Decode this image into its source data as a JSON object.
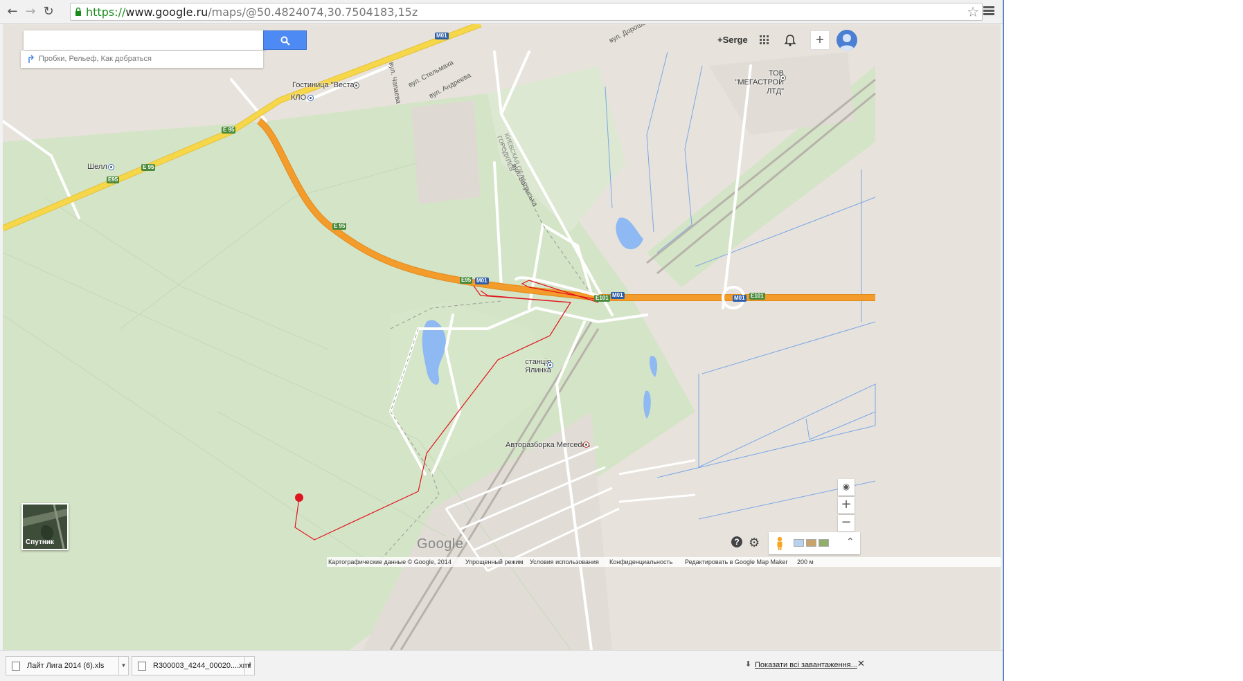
{
  "browser": {
    "url_scheme": "https://",
    "url_host": "www.google.ru",
    "url_path": "/maps/@50.4824074,30.7504183,15z",
    "back_icon": "arrow-left-icon",
    "forward_icon": "arrow-right-icon",
    "reload_icon": "reload-icon",
    "star_icon": "star-icon",
    "menu_icon": "hamburger-menu-icon"
  },
  "search": {
    "value": "",
    "hints": "Пробки, Рельеф, Как добраться"
  },
  "account": {
    "user_name": "+Serge",
    "apps_icon": "apps-grid-icon",
    "bell_icon": "bell-icon",
    "add_label": "+",
    "avatar_icon": "avatar-icon"
  },
  "map": {
    "labels": {
      "hotel": "Гостиница \"Веста\"",
      "klo": "КЛО",
      "shell": "Шелл",
      "company": "ТОВ \"МЕГАСТРОЙ ЛТД\"",
      "station": "станція Ялинка",
      "autoparts": "Авторазборка Mercedes",
      "street_bogunska": "вул. Богунська",
      "region_border": "КИЕВСКАЯ ОБЛАСТЬ ГОРОДКИЕВ",
      "street_stelmakha": "вул. Стельмаха",
      "street_andreeva": "вул. Андреева",
      "street_chapaeva": "вул. Чапаева",
      "street_doroshenka": "вул. Дорошенка"
    },
    "shields": [
      "M01",
      "E 95",
      "E 95",
      "E95",
      "E 95",
      "E95",
      "M01",
      "E101",
      "M01",
      "M01",
      "E101"
    ],
    "route_color": "#e0141e",
    "highway_color": "#f39c2b",
    "arterial_color": "#f7d74a",
    "water_color": "#8fb9f2",
    "park_color": "#d4e4c6"
  },
  "controls": {
    "satellite_label": "Спутник",
    "zoom_in": "+",
    "zoom_out": "−",
    "locate_icon": "my-location-icon",
    "help_icon": "help-icon",
    "help_label": "?",
    "settings_icon": "gear-icon",
    "pegman_icon": "pegman-icon",
    "expand_icon": "chevron-up-icon"
  },
  "google_logo": "Google",
  "footer": {
    "map_data": "Картографические данные © Google, 2014",
    "simple_mode": "Упрощенный режим",
    "terms": "Условия использования",
    "privacy": "Конфиденциальность",
    "edit": "Редактировать в Google Map Maker",
    "scale": "200 м"
  },
  "downloads": {
    "items": [
      {
        "name": "Лайт Лига 2014  (6).xls",
        "icon": "excel-file-icon"
      },
      {
        "name": "R300003_4244_00020....xml",
        "icon": "xml-file-icon"
      }
    ],
    "show_all": "Показати всі завантаження...",
    "close": "✕"
  }
}
